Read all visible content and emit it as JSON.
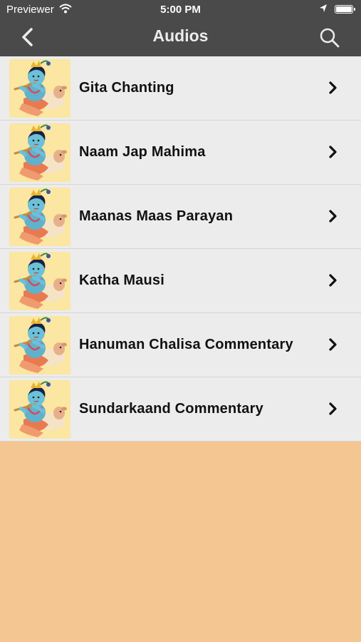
{
  "status_bar": {
    "carrier": "Previewer",
    "time": "5:00 PM",
    "icons": [
      "wifi-icon",
      "location-arrow-icon",
      "battery-icon"
    ]
  },
  "nav": {
    "title": "Audios",
    "back_icon": "chevron-left-icon",
    "search_icon": "search-icon"
  },
  "items": [
    {
      "label": "Gita Chanting"
    },
    {
      "label": "Naam Jap Mahima"
    },
    {
      "label": "Maanas Maas Parayan"
    },
    {
      "label": "Katha Mausi"
    },
    {
      "label": "Hanuman Chalisa Commentary"
    },
    {
      "label": "Sundarkaand Commentary"
    }
  ],
  "colors": {
    "bar": "#4a4a4a",
    "list_bg": "#ececec",
    "page_bg": "#f4c692",
    "thumb_bg": "#fbe6a2"
  }
}
